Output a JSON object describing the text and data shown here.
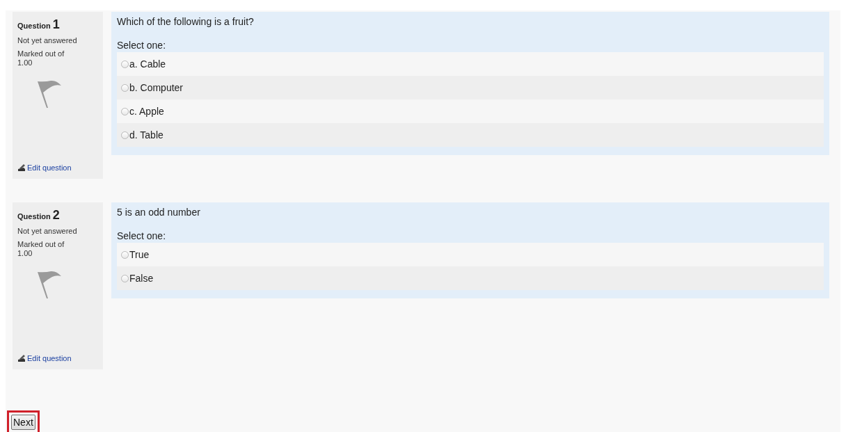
{
  "questions": [
    {
      "label": "Question",
      "number": "1",
      "state": "Not yet answered",
      "marks": "Marked out of 1.00",
      "edit_link": "Edit question",
      "text": "Which of the following is a fruit?",
      "prompt": "Select one:",
      "options": [
        {
          "label": "a. Cable",
          "selected": false
        },
        {
          "label": "b. Computer",
          "selected": false
        },
        {
          "label": "c. Apple",
          "selected": false
        },
        {
          "label": "d. Table",
          "selected": false
        }
      ]
    },
    {
      "label": "Question",
      "number": "2",
      "state": "Not yet answered",
      "marks": "Marked out of 1.00",
      "edit_link": "Edit question",
      "text": "5 is an odd number",
      "prompt": "Select one:",
      "options": [
        {
          "label": "True",
          "selected": false
        },
        {
          "label": "False",
          "selected": false
        }
      ]
    }
  ],
  "next_button": {
    "label": "Next",
    "highlighted": true
  }
}
